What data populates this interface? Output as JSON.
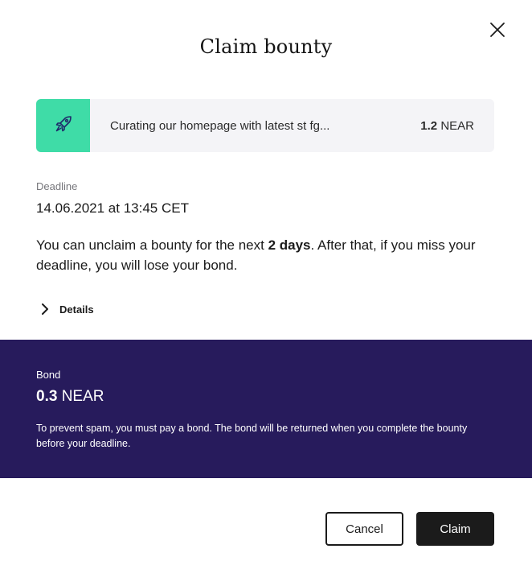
{
  "dialog": {
    "title": "Claim bounty",
    "close_icon": "close-icon"
  },
  "bounty": {
    "icon": "rocket-icon",
    "icon_bg_color": "#3fdca7",
    "description": "Curating our homepage with latest st fg...",
    "amount": "1.2",
    "currency": "NEAR"
  },
  "deadline": {
    "label": "Deadline",
    "value": "14.06.2021 at 13:45 CET"
  },
  "unclaim": {
    "prefix": "You can unclaim a bounty for the next ",
    "highlight": "2 days",
    "suffix": ". After that, if you miss your deadline, you will lose your bond."
  },
  "details": {
    "label": "Details",
    "icon": "chevron-right-icon"
  },
  "bond": {
    "label": "Bond",
    "amount": "0.3",
    "currency": "NEAR",
    "note": "To prevent spam, you must pay a bond. The bond will be returned when you complete the bounty before your deadline.",
    "panel_color": "#271b5c"
  },
  "actions": {
    "cancel_label": "Cancel",
    "claim_label": "Claim"
  }
}
